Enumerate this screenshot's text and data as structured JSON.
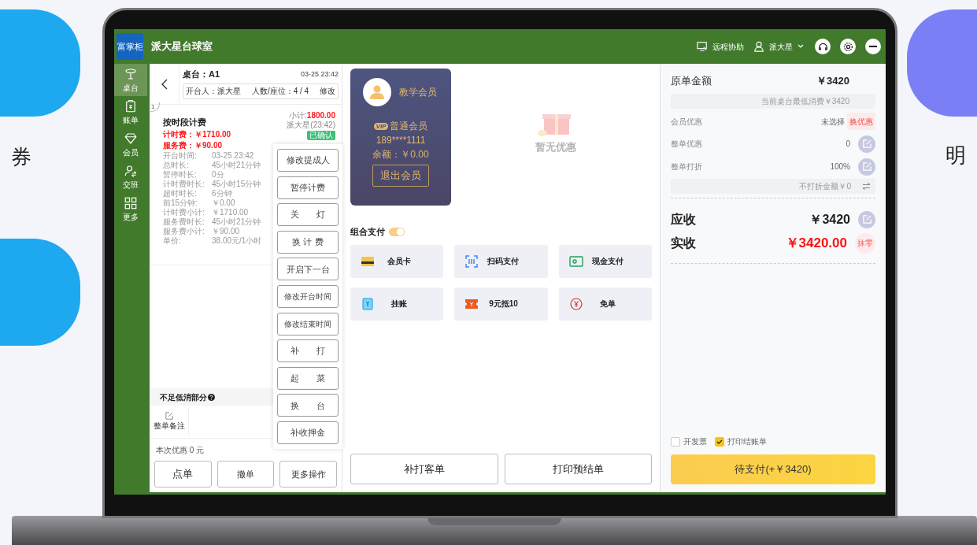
{
  "background": {
    "left_texts": [
      "券"
    ],
    "right_texts": [
      "明"
    ]
  },
  "header": {
    "logo": "富掌柜",
    "title": "派大星台球室",
    "remote": "远程协助",
    "user": "派大星"
  },
  "sidebar": [
    {
      "label": "桌台",
      "kind": "table",
      "selected": true
    },
    {
      "label": "账单",
      "kind": "bill",
      "selected": false
    },
    {
      "label": "会员",
      "kind": "member",
      "selected": false
    },
    {
      "label": "交班",
      "kind": "shift",
      "selected": false
    },
    {
      "label": "更多",
      "kind": "more",
      "selected": false
    }
  ],
  "table": {
    "name": "桌台：A1",
    "time": "03-25 23:42",
    "opener": "开台人：派大星",
    "seats": "人数/座位：4 / 4",
    "edit": "修改"
  },
  "item": {
    "index": "1",
    "title": "按时段计费",
    "subtotal_label": "小计:",
    "subtotal": "1800.00",
    "by": "派大星(23:42)",
    "status": "已确认",
    "fees": [
      "计时费：￥1710.00",
      "服务费：￥90.00"
    ],
    "details": [
      {
        "label": "开台时间:",
        "value": "03-25 23:42"
      },
      {
        "label": "总时长:",
        "value": "45小时21分钟"
      },
      {
        "label": "暂停时长:",
        "value": "0分"
      },
      {
        "label": "计时费时长:",
        "value": "45小时15分钟"
      },
      {
        "label": "超时时长:",
        "value": "6分钟"
      },
      {
        "label": "前15分钟:",
        "value": "￥0.00"
      },
      {
        "label": "计时费小计:",
        "value": "￥1710.00"
      },
      {
        "label": "服务费时长:",
        "value": "45小时21分钟"
      },
      {
        "label": "服务费小计:",
        "value": "￥90.00"
      },
      {
        "label": "单价:",
        "value": "38.00元/1小时"
      }
    ]
  },
  "min_charge": "不足低消部分",
  "note": "整单备注",
  "discount": "本次优惠 0 元",
  "actions": [
    "点单",
    "撤单",
    "更多操作"
  ],
  "more_menu": [
    "修改提成人",
    "暂停计费",
    "关　　灯",
    "换 计 费",
    "开启下一台",
    "修改开台时间",
    "修改结束时间",
    "补　　打",
    "起　　菜",
    "换　　台",
    "补收押金"
  ],
  "member": {
    "name": "教学会员",
    "badge": "VIP",
    "level": "普通会员",
    "phone": "189****1111",
    "balance": "余额：￥0.00",
    "logout": "退出会员"
  },
  "empty": "暂无优惠",
  "combo_pay": {
    "label": "组合支付",
    "on": true
  },
  "pay_methods": [
    {
      "label": "会员卡",
      "kind": "card"
    },
    {
      "label": "扫码支付",
      "kind": "scan"
    },
    {
      "label": "现金支付",
      "kind": "cash"
    },
    {
      "label": "挂账",
      "kind": "credit"
    },
    {
      "label": "9元抵10",
      "kind": "coupon"
    },
    {
      "label": "免单",
      "kind": "free"
    }
  ],
  "bottom_buttons": [
    "补打客单",
    "打印预结单"
  ],
  "summary": {
    "original_label": "原单金额",
    "original": "￥3420",
    "min_note": "当前桌台最低消费￥3420",
    "member_label": "会员优惠",
    "member_value": "未选择",
    "member_action": "换优惠",
    "order_discount_label": "整单优惠",
    "order_discount": "0",
    "rate_label": "整单打折",
    "rate": "100%",
    "no_discount": "不打折金额￥0",
    "due_label": "应收",
    "due": "￥3420",
    "paid_label": "实收",
    "paid": "￥3420.00",
    "round": "抹零"
  },
  "options": [
    {
      "label": "开发票",
      "checked": false
    },
    {
      "label": "打印结账单",
      "checked": true
    }
  ],
  "pay_button": "待支付(+￥3420)"
}
